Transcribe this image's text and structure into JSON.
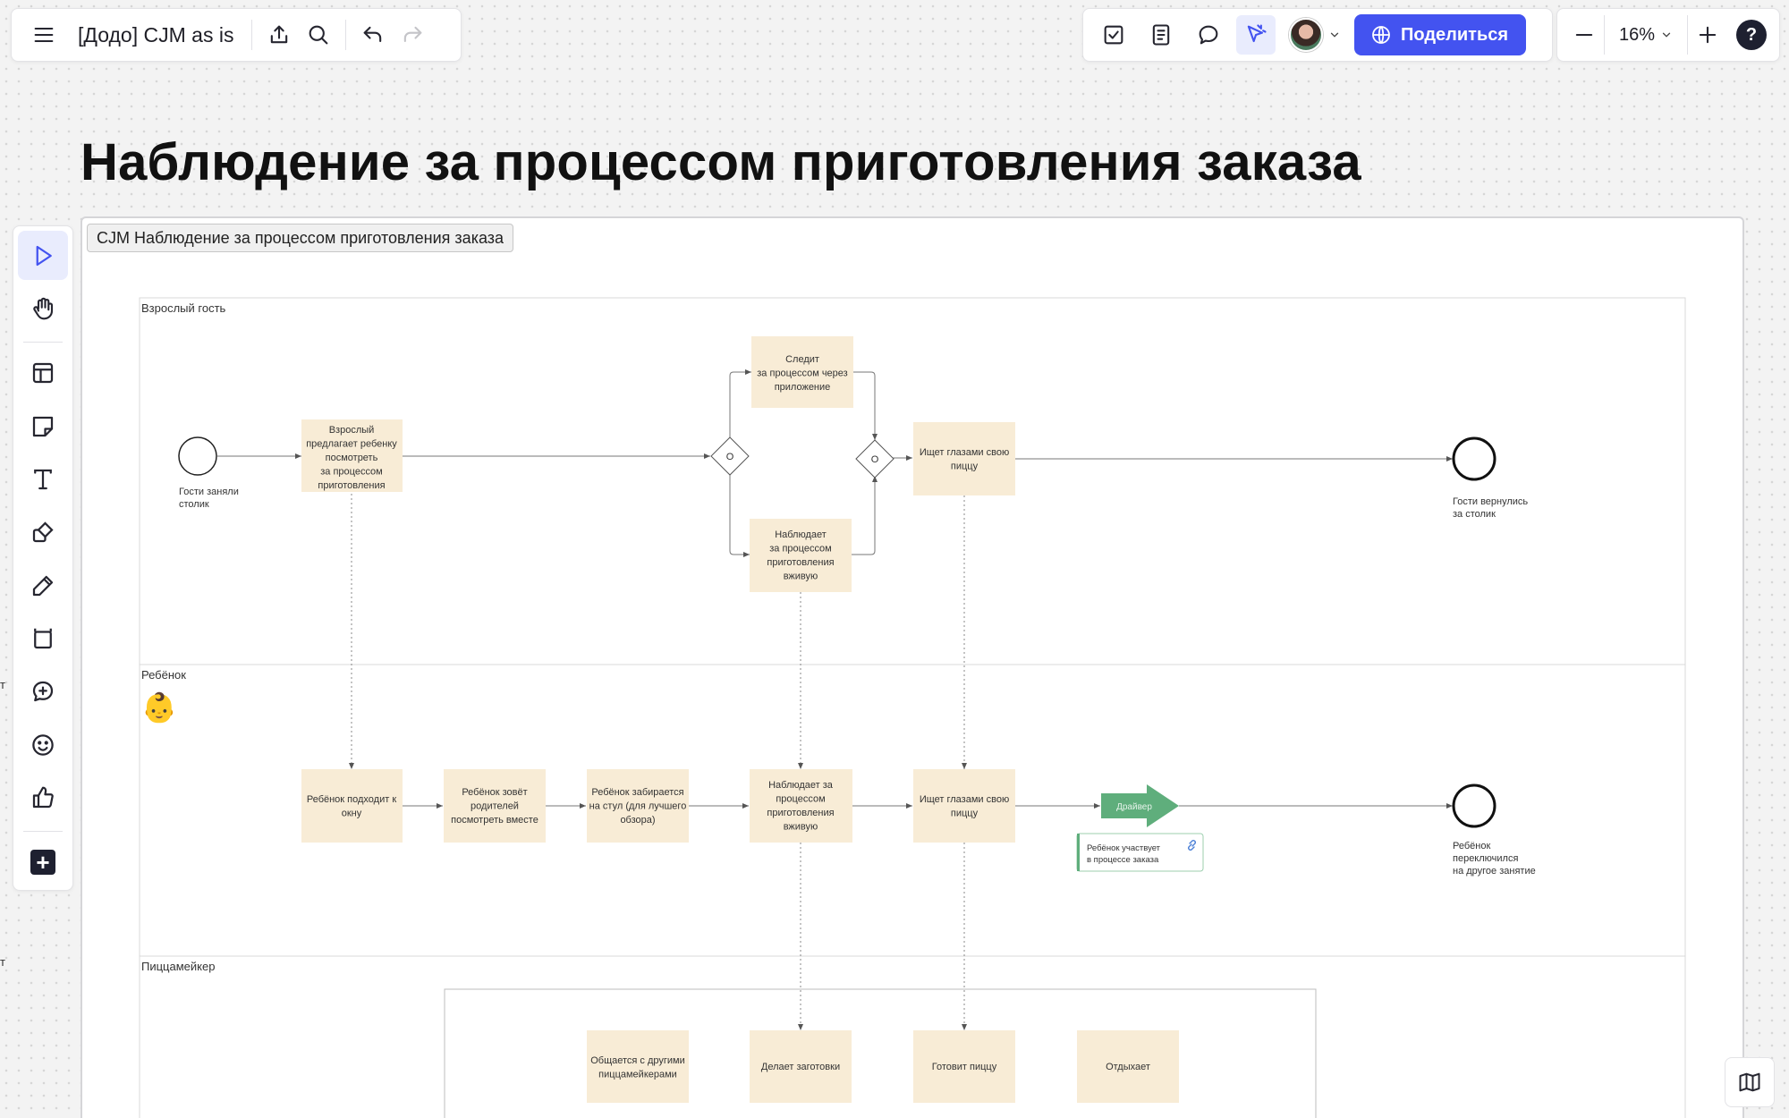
{
  "app": {
    "board_name": "[Додо] CJM as is",
    "share_label": "Поделиться",
    "zoom_level": "16%",
    "help_label": "?",
    "accent_color": "#4353f0"
  },
  "top_toolbar_left": {
    "icons": [
      "menu-icon",
      "export-icon",
      "search-icon",
      "undo-icon",
      "redo-icon"
    ]
  },
  "top_toolbar_right": {
    "icons": [
      "task-icon",
      "notes-icon",
      "comment-icon",
      "pointer-share-icon",
      "avatar",
      "share-button"
    ]
  },
  "left_toolbar": {
    "tools": [
      "select-tool",
      "hand-tool",
      "templates-tool",
      "sticky-note-tool",
      "text-tool",
      "shapes-tool",
      "pen-tool",
      "frame-tool",
      "comment-tool",
      "reactions-tool",
      "voting-tool",
      "more-tools"
    ]
  },
  "canvas": {
    "board_title": "Наблюдение за процессом приготовления заказа",
    "frame_label": "CJM Наблюдение за процессом приготовления заказа",
    "edge_texts": [
      "т",
      "т"
    ]
  },
  "lanes": {
    "adult": "Взрослый гость",
    "child": "Ребёнок",
    "pizzamaker": "Пиццамейкер",
    "child_emoji": "👶"
  },
  "adult_lane": {
    "start_event": [
      "Гости заняли",
      "столик"
    ],
    "step_offer": [
      "Взрослый",
      "предлагает ребенку",
      "посмотреть",
      "за процессом",
      "приготовления"
    ],
    "step_app": [
      "Следит",
      "за процессом через",
      "приложение"
    ],
    "step_live": [
      "Наблюдает",
      "за процессом",
      "приготовления",
      "вживую"
    ],
    "step_look": [
      "Ищет глазами свою",
      "пиццу"
    ],
    "gateway_label": "O",
    "end_event": [
      "Гости вернулись",
      "за столик"
    ]
  },
  "child_lane": {
    "step_window": [
      "Ребёнок подходит к",
      "окну"
    ],
    "step_call": [
      "Ребёнок зовёт",
      "родителей",
      "посмотреть вместе"
    ],
    "step_chair": [
      "Ребёнок забирается",
      "на стул (для лучшего",
      "обзора)"
    ],
    "step_watch": [
      "Наблюдает за",
      "процессом",
      "приготовления",
      "вживую"
    ],
    "step_look": [
      "Ищет глазами свою",
      "пиццу"
    ],
    "driver_label": "Драйвер",
    "driver_color": "#5fae7c",
    "driver_note": [
      "Ребёнок участвует",
      "в процессе заказа"
    ],
    "end_event": [
      "Ребёнок",
      "переключился",
      "на другое занятие"
    ]
  },
  "pizzamaker_lane": {
    "step_chat": [
      "Общается с другими",
      "пиццамейкерами"
    ],
    "step_prep": [
      "Делает заготовки"
    ],
    "step_cook": [
      "Готовит пиццу"
    ],
    "step_rest": [
      "Отдыхает"
    ]
  }
}
